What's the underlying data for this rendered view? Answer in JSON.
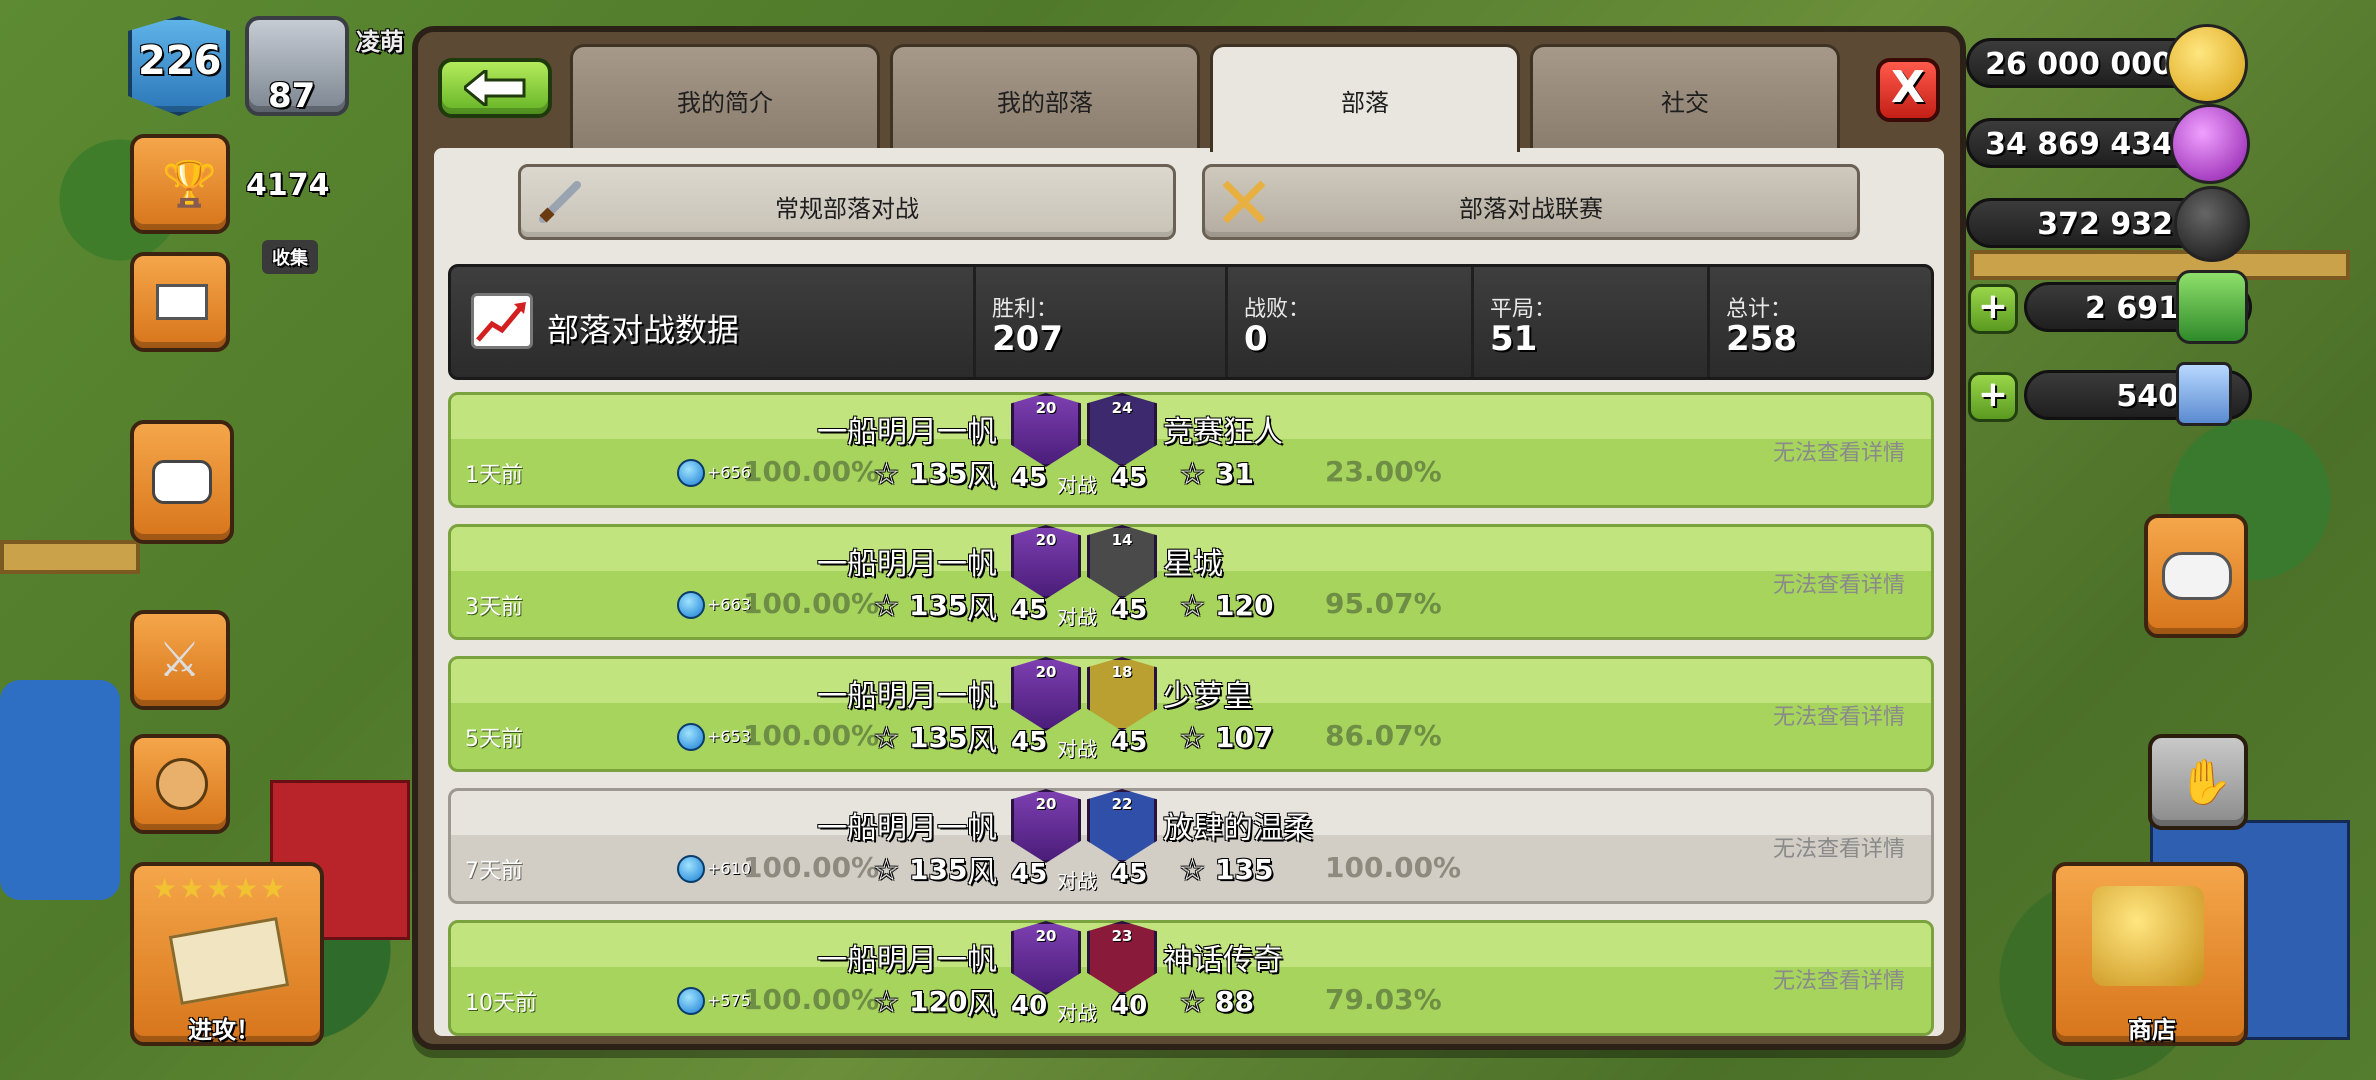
{
  "player": {
    "level": "226",
    "name": "凌萌",
    "league_num": "87",
    "trophies": "4174",
    "collect_label": "收集"
  },
  "resources": [
    {
      "name": "gold",
      "value": "26 000 000",
      "color": "#f1c232"
    },
    {
      "name": "elixir",
      "value": "34 869 434",
      "color": "#b23bd6"
    },
    {
      "name": "dark-elixir",
      "value": "372 932",
      "color": "#2a2a2a"
    },
    {
      "name": "gems",
      "value": "2 691",
      "color": "#49b64a"
    },
    {
      "name": "ticket",
      "value": "540",
      "color": "#6aa5e0"
    }
  ],
  "attack_label": "进攻！",
  "shop_label": "商店",
  "tabs": [
    {
      "label": "我的简介"
    },
    {
      "label": "我的部落"
    },
    {
      "label": "部落"
    },
    {
      "label": "社交"
    }
  ],
  "subtabs": [
    {
      "label": "常规部落对战"
    },
    {
      "label": "部落对战联赛"
    }
  ],
  "stats": {
    "title": "部落对战数据",
    "wins_label": "胜利：",
    "wins": "207",
    "losses_label": "战败：",
    "losses": "0",
    "draws_label": "平局：",
    "draws": "51",
    "total_label": "总计：",
    "total": "258"
  },
  "vs_label": "对战",
  "detail_label": "无法查看详情",
  "wars": [
    {
      "ago": "1天前",
      "our_name": "一船明月一帆风",
      "our_level": "20",
      "opp_name": "竞赛狂人",
      "opp_level": "24",
      "gem": "+656",
      "our_pct": "100.00%",
      "our_stars": "135",
      "size": "45",
      "opp_stars": "31",
      "opp_pct": "23.00%",
      "style": "green",
      "opp_color": "#3d2a6e"
    },
    {
      "ago": "3天前",
      "our_name": "一船明月一帆风",
      "our_level": "20",
      "opp_name": "星城",
      "opp_level": "14",
      "gem": "+663",
      "our_pct": "100.00%",
      "our_stars": "135",
      "size": "45",
      "opp_stars": "120",
      "opp_pct": "95.07%",
      "style": "green",
      "opp_color": "#4a4a4a"
    },
    {
      "ago": "5天前",
      "our_name": "一船明月一帆风",
      "our_level": "20",
      "opp_name": "少萝皇",
      "opp_level": "18",
      "gem": "+653",
      "our_pct": "100.00%",
      "our_stars": "135",
      "size": "45",
      "opp_stars": "107",
      "opp_pct": "86.07%",
      "style": "green",
      "opp_color": "#b9a030"
    },
    {
      "ago": "7天前",
      "our_name": "一船明月一帆风",
      "our_level": "20",
      "opp_name": "放肆的温柔",
      "opp_level": "22",
      "gem": "+610",
      "our_pct": "100.00%",
      "our_stars": "135",
      "size": "45",
      "opp_stars": "135",
      "opp_pct": "100.00%",
      "style": "gray",
      "opp_color": "#2f4fa8"
    },
    {
      "ago": "10天前",
      "our_name": "一船明月一帆风",
      "our_level": "20",
      "opp_name": "神话传奇",
      "opp_level": "23",
      "gem": "+575",
      "our_pct": "100.00%",
      "our_stars": "120",
      "size": "40",
      "opp_stars": "88",
      "opp_pct": "79.03%",
      "style": "green",
      "opp_color": "#8a1a3a"
    }
  ]
}
